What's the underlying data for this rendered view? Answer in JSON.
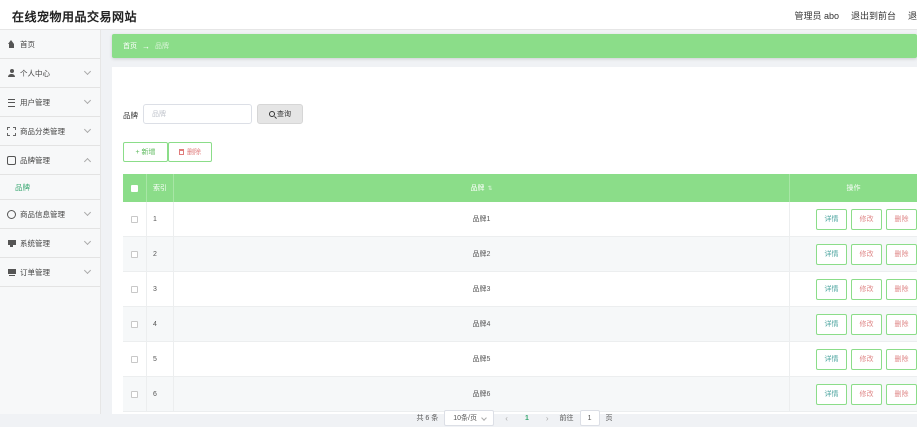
{
  "header": {
    "site_title": "在线宠物用品交易网站",
    "admin_label": "管理员 abo",
    "back_to_front": "退出到前台",
    "logout": "退"
  },
  "sidebar": {
    "items": [
      {
        "label": "首页",
        "icon": "home-icon"
      },
      {
        "label": "个人中心",
        "icon": "user-icon"
      },
      {
        "label": "用户管理",
        "icon": "list-icon"
      },
      {
        "label": "商品分类管理",
        "icon": "frame-icon"
      },
      {
        "label": "品牌管理",
        "icon": "chat-icon",
        "expanded": true
      },
      {
        "label": "商品信息管理",
        "icon": "globe-icon"
      },
      {
        "label": "系统管理",
        "icon": "monitor-icon"
      },
      {
        "label": "订单管理",
        "icon": "order-icon"
      }
    ],
    "submenu": {
      "label": "品牌"
    }
  },
  "breadcrumb": {
    "home": "首页",
    "separator": "→",
    "current": "品牌"
  },
  "search": {
    "label": "品牌",
    "placeholder": "品牌",
    "query_button": "查询"
  },
  "toolbar": {
    "add_label": "+ 新增",
    "delete_label": "删除"
  },
  "table": {
    "headers": {
      "index": "索引",
      "brand": "品牌",
      "ops": "操作"
    },
    "rows": [
      {
        "index": "1",
        "brand": "品牌1"
      },
      {
        "index": "2",
        "brand": "品牌2"
      },
      {
        "index": "3",
        "brand": "品牌3"
      },
      {
        "index": "4",
        "brand": "品牌4"
      },
      {
        "index": "5",
        "brand": "品牌5"
      },
      {
        "index": "6",
        "brand": "品牌6"
      }
    ],
    "op_labels": {
      "detail": "详情",
      "edit": "修改",
      "delete": "删除"
    }
  },
  "pagination": {
    "total": "共 6 条",
    "page_size": "10条/页",
    "prev": "‹",
    "current_page": "1",
    "next": "›",
    "goto_label": "前往",
    "goto_value": "1",
    "page_suffix": "页"
  },
  "colors": {
    "accent_green": "#8bdd89",
    "link_green": "#3aa872",
    "danger_red": "#e07b7b"
  }
}
